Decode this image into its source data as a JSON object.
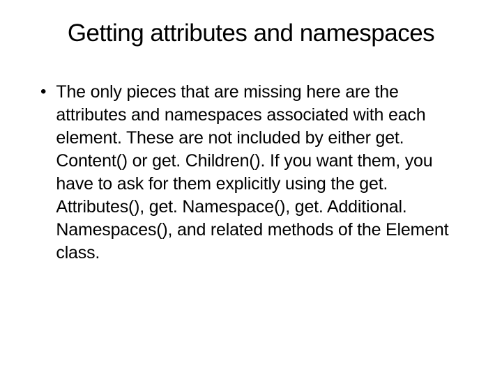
{
  "title": "Getting attributes and namespaces",
  "bullets": [
    {
      "text": "The only pieces that are missing here are the attributes and namespaces associated with each element. These are not included by either get. Content() or get. Children(). If you want them, you have to ask for them explicitly using the get. Attributes(), get. Namespace(), get. Additional. Namespaces(), and related methods of the Element class."
    }
  ]
}
